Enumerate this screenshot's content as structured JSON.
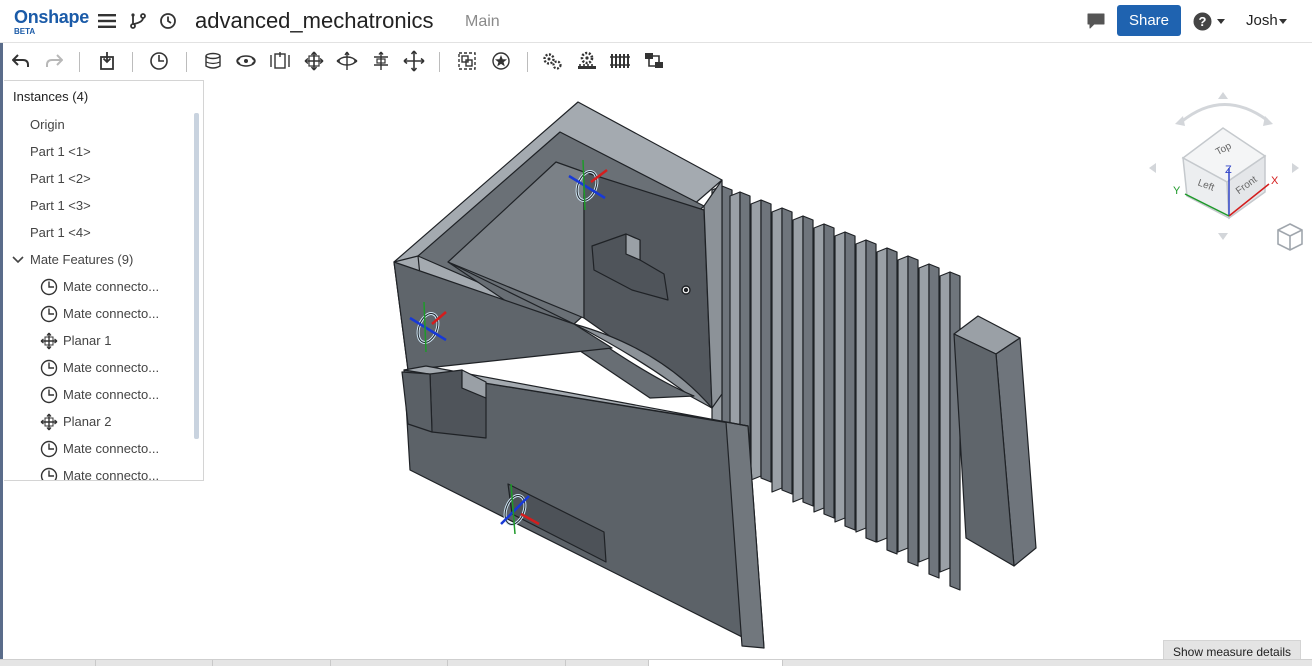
{
  "app": {
    "logo": "Onshape",
    "logo_badge": "BETA",
    "document_title": "advanced_mechatronics",
    "branch": "Main",
    "share_label": "Share",
    "user_name": "Josh"
  },
  "toolbar": {
    "tools": [
      "undo-icon",
      "redo-icon",
      "insert-icon",
      "mate-connector-icon",
      "fastened-mate-icon",
      "revolute-mate-icon",
      "slider-mate-icon",
      "planar-mate-icon",
      "cylindrical-mate-icon",
      "pin-slot-mate-icon",
      "ball-mate-icon",
      "parallel-mate-icon",
      "group-icon",
      "replicate-icon",
      "gear-relation-icon",
      "rack-pinion-icon",
      "screw-relation-icon",
      "linear-relation-icon"
    ]
  },
  "panel": {
    "title": "Instances (4)",
    "instances": [
      {
        "label": "Origin"
      },
      {
        "label": "Part 1 <1>"
      },
      {
        "label": "Part 1 <2>"
      },
      {
        "label": "Part 1 <3>"
      },
      {
        "label": "Part 1 <4>"
      }
    ],
    "mate_group": "Mate Features (9)",
    "mates": [
      {
        "label": "Mate connecto...",
        "icon": "mate-connector-icon"
      },
      {
        "label": "Mate connecto...",
        "icon": "mate-connector-icon"
      },
      {
        "label": "Planar 1",
        "icon": "planar-mate-icon"
      },
      {
        "label": "Mate connecto...",
        "icon": "mate-connector-icon"
      },
      {
        "label": "Mate connecto...",
        "icon": "mate-connector-icon"
      },
      {
        "label": "Planar 2",
        "icon": "planar-mate-icon"
      },
      {
        "label": "Mate connecto...",
        "icon": "mate-connector-icon"
      },
      {
        "label": "Mate connecto...",
        "icon": "mate-connector-icon"
      }
    ]
  },
  "view_cube": {
    "top": "Top",
    "left": "Left",
    "front": "Front",
    "axis_x": "X",
    "axis_y": "Y",
    "axis_z": "Z"
  },
  "measure": {
    "label": "Show measure details"
  },
  "colors": {
    "brand": "#1b5ba8",
    "share": "#1f63b0",
    "part_face": "#6f757c",
    "part_dark": "#54595f",
    "part_light": "#9aa0a6"
  }
}
